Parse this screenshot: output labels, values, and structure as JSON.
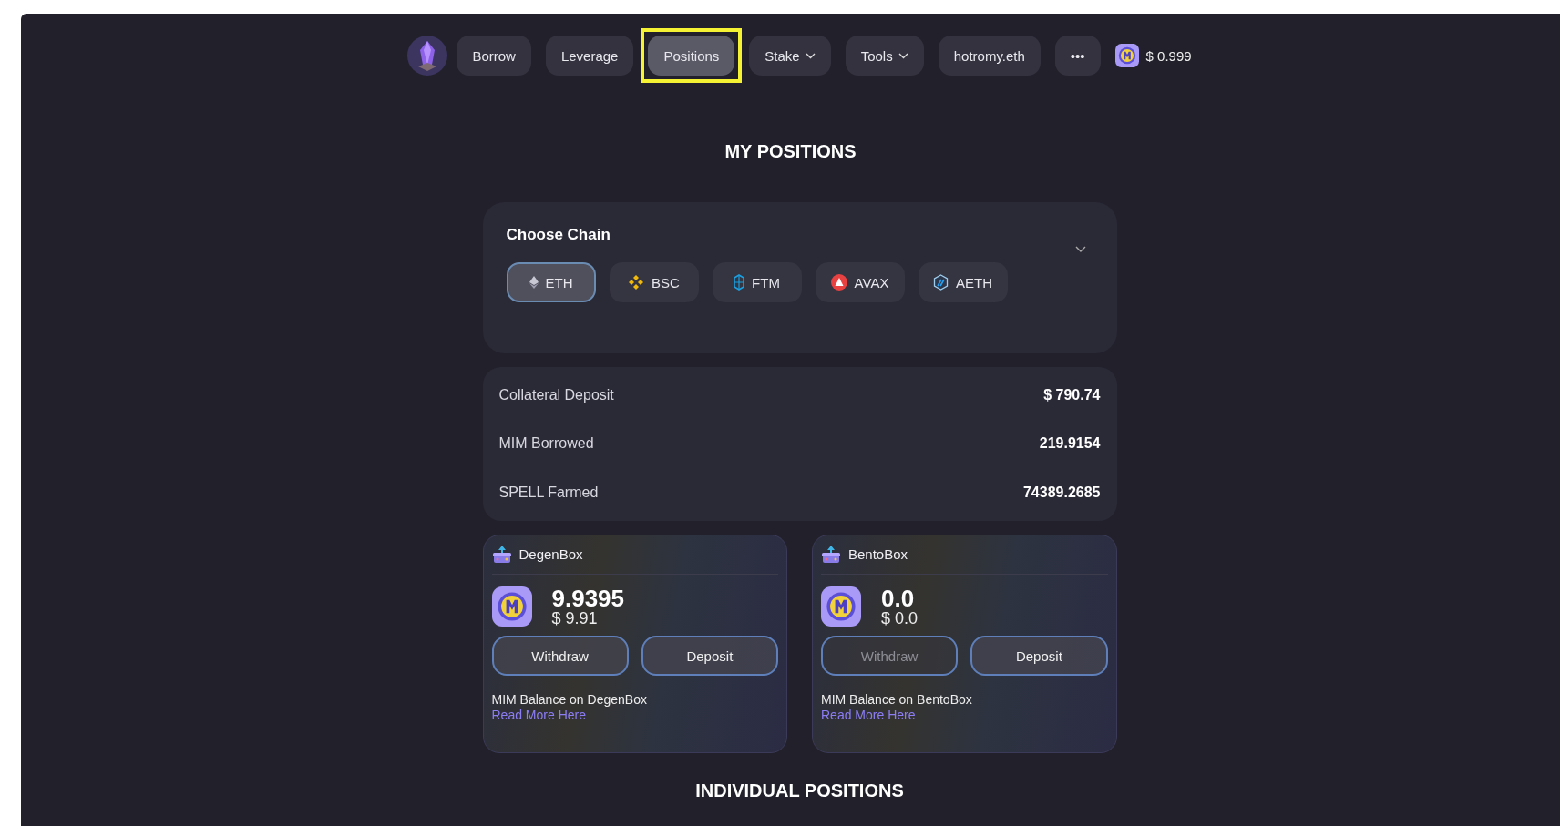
{
  "nav": {
    "items": [
      {
        "label": "Borrow",
        "selected": false,
        "highlighted": false,
        "dropdown": false
      },
      {
        "label": "Leverage",
        "selected": false,
        "highlighted": false,
        "dropdown": false
      },
      {
        "label": "Positions",
        "selected": true,
        "highlighted": true,
        "dropdown": false
      },
      {
        "label": "Stake",
        "selected": false,
        "highlighted": false,
        "dropdown": true
      },
      {
        "label": "Tools",
        "selected": false,
        "highlighted": false,
        "dropdown": true
      },
      {
        "label": "hotromy.eth",
        "selected": false,
        "highlighted": false,
        "dropdown": false
      },
      {
        "label": "•••",
        "selected": false,
        "highlighted": false,
        "dropdown": false
      }
    ],
    "price": "$ 0.999"
  },
  "page_title": "MY POSITIONS",
  "chain_selector": {
    "title": "Choose Chain",
    "expanded": false,
    "chains": [
      {
        "label": "ETH",
        "kind": "eth",
        "selected": true
      },
      {
        "label": "BSC",
        "kind": "bsc",
        "selected": false
      },
      {
        "label": "FTM",
        "kind": "ftm",
        "selected": false
      },
      {
        "label": "AVAX",
        "kind": "avax",
        "selected": false
      },
      {
        "label": "AETH",
        "kind": "aeth",
        "selected": false
      }
    ]
  },
  "totals": [
    {
      "label": "Collateral Deposit",
      "value": "$ 790.74"
    },
    {
      "label": "MIM Borrowed",
      "value": "219.9154"
    },
    {
      "label": "SPELL Farmed",
      "value": "74389.2685"
    }
  ],
  "boxes": [
    {
      "name": "DegenBox",
      "amount": "9.9395",
      "usd": "$ 9.91",
      "actions": [
        {
          "label": "Withdraw",
          "disabled": false
        },
        {
          "label": "Deposit",
          "disabled": false
        }
      ],
      "note": "MIM Balance on DegenBox",
      "link": "Read More Here"
    },
    {
      "name": "BentoBox",
      "amount": "0.0",
      "usd": "$ 0.0",
      "actions": [
        {
          "label": "Withdraw",
          "disabled": true
        },
        {
          "label": "Deposit",
          "disabled": false
        }
      ],
      "note": "MIM Balance on BentoBox",
      "link": "Read More Here"
    }
  ],
  "section_title": "INDIVIDUAL POSITIONS"
}
